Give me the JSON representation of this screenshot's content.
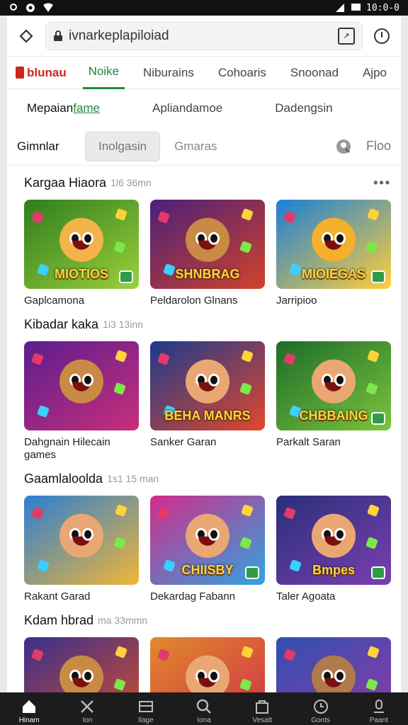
{
  "status": {
    "time": "10:0-0"
  },
  "browser": {
    "url": "ivnarkeplapiloiad"
  },
  "tabs": {
    "brand": "blunau",
    "items": [
      "Noike",
      "Niburains",
      "Cohoaris",
      "Snoonad",
      "Ajpo"
    ]
  },
  "subtabs": {
    "first_prefix": "Mepaian",
    "first_highlight": "fame",
    "items": [
      "Apliandamoe",
      "Dadengsin"
    ]
  },
  "filter": {
    "label": "Gimnlar",
    "chip": "Inolgasin",
    "plain": "Gmaras",
    "right_label": "Floo"
  },
  "sections": [
    {
      "title": "Kargaa Hiaora",
      "meta": "1l6 36mn",
      "cards": [
        {
          "title": "Gaplcamona",
          "logo": "MIOTIOS",
          "colors": [
            "#2f7d1e",
            "#9ad03a"
          ],
          "face": "#f2b34a"
        },
        {
          "title": "Peldarolon Glnans",
          "logo": "SHNBRAG",
          "colors": [
            "#4b1f7a",
            "#d0432a"
          ],
          "face": "#c98a45"
        },
        {
          "title": "Jarripioo",
          "logo": "MIOIEGAS",
          "colors": [
            "#1a7fd8",
            "#ffce3a"
          ],
          "face": "#f3b02a"
        }
      ]
    },
    {
      "title": "Kibadar kaka",
      "meta": "1i3 13inn",
      "cards": [
        {
          "title": "Dahgnain Hilecain\ngames",
          "logo": "",
          "colors": [
            "#5b1d8f",
            "#c82f7a"
          ],
          "face": "#c98a45"
        },
        {
          "title": "Sanker Garan",
          "logo": "BEHA MANRS",
          "colors": [
            "#1b3a8c",
            "#e2472d"
          ],
          "face": "#e9a873"
        },
        {
          "title": "Parkalt Saran",
          "logo": "CHBBAING",
          "colors": [
            "#1e6b2a",
            "#7ac53c"
          ],
          "face": "#e9a873"
        }
      ]
    },
    {
      "title": "Gaamlaloolda",
      "meta": "1s1 15 man",
      "cards": [
        {
          "title": "Rakant Garad",
          "logo": "",
          "colors": [
            "#2b7fd2",
            "#f1b537"
          ],
          "face": "#e9a873"
        },
        {
          "title": "Dekardag Fabann",
          "logo": "CHIISBY",
          "colors": [
            "#d12c8a",
            "#2fa4e0"
          ],
          "face": "#e9a873"
        },
        {
          "title": "Taler Agoata",
          "logo": "Bmpes",
          "colors": [
            "#2a2f7a",
            "#7a3fb0"
          ],
          "face": "#e9a873"
        }
      ]
    },
    {
      "title": "Kdam hbrad",
      "meta": "ma 33mmn",
      "cards": [
        {
          "title": "",
          "logo": "",
          "colors": [
            "#3a2f8c",
            "#d24d2b"
          ],
          "face": "#c98a45"
        },
        {
          "title": "",
          "logo": "",
          "colors": [
            "#e08a2a",
            "#d12f4a"
          ],
          "face": "#e9a873"
        },
        {
          "title": "",
          "logo": "",
          "colors": [
            "#3050b0",
            "#8f3aa8"
          ],
          "face": "#b07a4a"
        }
      ]
    }
  ],
  "bottom_nav": [
    {
      "label": "Hinam",
      "icon": "home-icon"
    },
    {
      "label": "Ion",
      "icon": "tools-icon"
    },
    {
      "label": "Ilage",
      "icon": "board-icon"
    },
    {
      "label": "Iona",
      "icon": "search-icon"
    },
    {
      "label": "Vesatt",
      "icon": "bag-icon"
    },
    {
      "label": "Gonts",
      "icon": "clock-icon"
    },
    {
      "label": "Paant",
      "icon": "mic-icon"
    }
  ]
}
